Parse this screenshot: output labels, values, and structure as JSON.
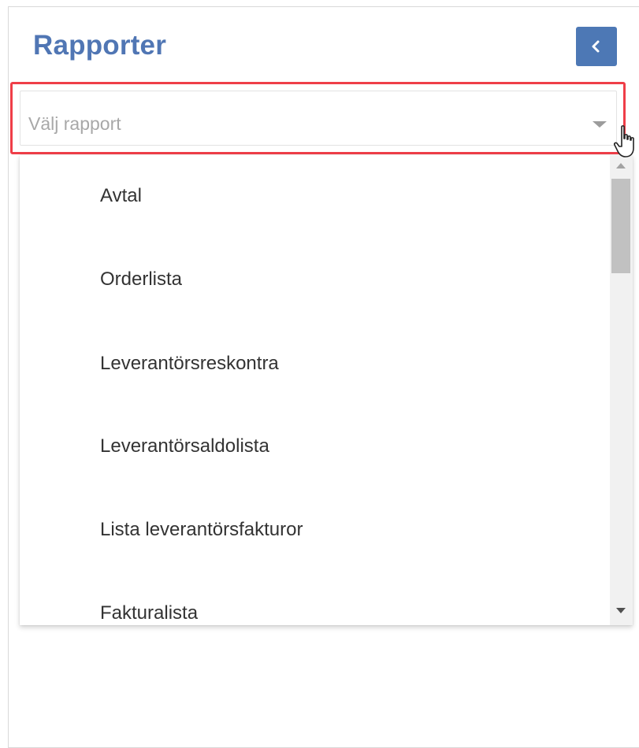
{
  "panel": {
    "title": "Rapporter",
    "collapse_icon": "chevron-left-icon"
  },
  "report_select": {
    "placeholder": "Välj rapport",
    "caret_icon": "caret-down-icon",
    "options": [
      "Avtal",
      "Orderlista",
      "Leverantörsreskontra",
      "Leverantörsaldolista",
      "Lista leverantörsfakturor",
      "Fakturalista"
    ]
  },
  "colors": {
    "title": "#5076b4",
    "button": "#4d78b5",
    "highlight_border": "#ef3e48",
    "placeholder": "#a8a8a8",
    "option_text": "#333333"
  }
}
